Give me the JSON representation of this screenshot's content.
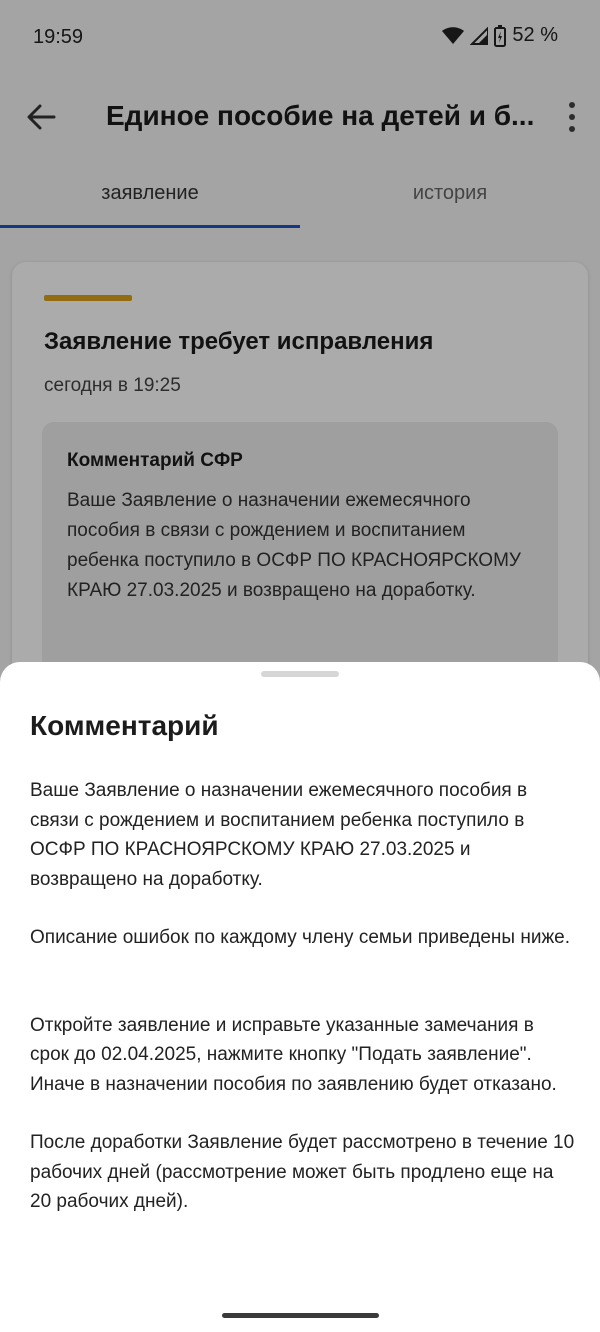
{
  "status_bar": {
    "time": "19:59",
    "battery": "52 %"
  },
  "app_bar": {
    "title": "Единое пособие на детей и б..."
  },
  "tabs": [
    {
      "label": "заявление",
      "selected": true
    },
    {
      "label": "история",
      "selected": false
    }
  ],
  "card": {
    "title": "Заявление требует исправления",
    "time": "сегодня в 19:25",
    "comment_heading": "Комментарий СФР",
    "comment_text": "Ваше Заявление о назначении ежемесячного пособия в связи с рождением и воспитанием ребенка поступило в ОСФР ПО КРАСНОЯРСКОМУ КРАЮ 27.03.2025 и возвращено на доработку.",
    "accent_color": "#d9a21a"
  },
  "sheet": {
    "title": "Комментарий",
    "paragraphs": [
      "Ваше Заявление о назначении ежемесячного пособия в связи с рождением и воспитанием ребенка поступило в ОСФР ПО КРАСНОЯРСКОМУ КРАЮ 27.03.2025 и возвращено на доработку.",
      "Описание ошибок по каждому члену семьи приведены ниже.",
      "Откройте заявление и исправьте указанные замечания в срок до 02.04.2025, нажмите кнопку \"Подать заявление\". Иначе в назначении пособия по заявлению будет отказано.",
      "После доработки Заявление будет рассмотрено в течение 10 рабочих дней (рассмотрение может быть продлено еще на 20 рабочих дней)."
    ]
  },
  "colors": {
    "tab_indicator": "#1f56c4",
    "scrim": "rgba(0,0,0,0.33)"
  }
}
